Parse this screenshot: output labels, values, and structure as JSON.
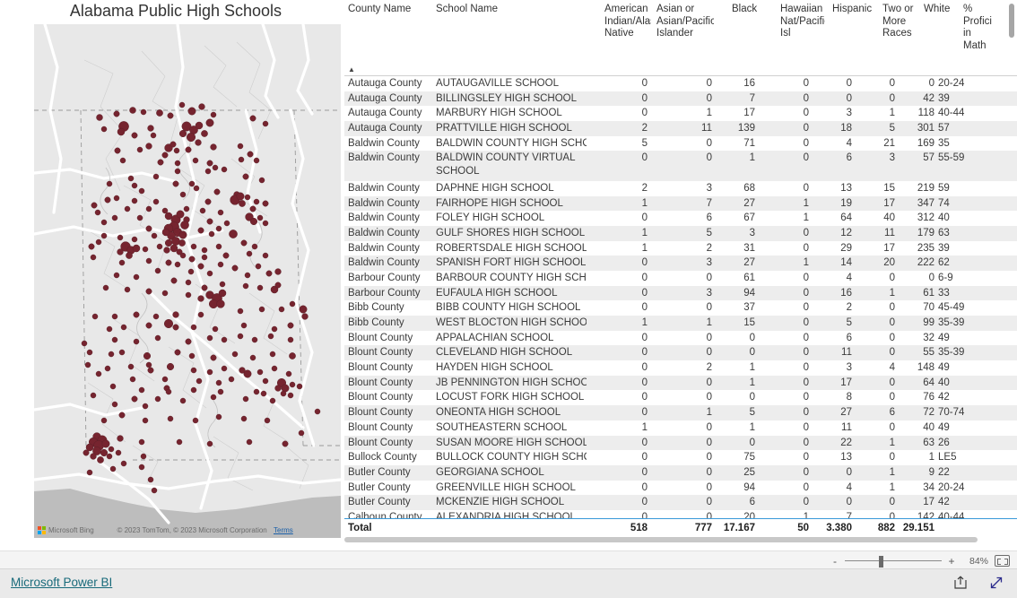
{
  "map": {
    "title": "Alabama Public High Schools",
    "attribution": "© 2023 TomTom, © 2023 Microsoft Corporation",
    "terms_label": "Terms",
    "bing_label": "Microsoft Bing",
    "bubble_color": "#6d1420",
    "background_color": "#e8e8e8",
    "water_color": "#b9b9b9",
    "road_color": "#ffffff"
  },
  "table": {
    "columns": [
      {
        "key": "county",
        "label": "County Name",
        "type": "text"
      },
      {
        "key": "school",
        "label": "School Name",
        "type": "text"
      },
      {
        "key": "amerind",
        "label": "American Indian/Alaska Native",
        "type": "num"
      },
      {
        "key": "asian",
        "label": "Asian or Asian/Pacific Islander",
        "type": "num"
      },
      {
        "key": "black",
        "label": "Black",
        "type": "num"
      },
      {
        "key": "hawaiian",
        "label": "Hawaiian Nat/Pacific Isl",
        "type": "num"
      },
      {
        "key": "hispanic",
        "label": "Hispanic",
        "type": "num"
      },
      {
        "key": "twomore",
        "label": "Two or More Races",
        "type": "num"
      },
      {
        "key": "white",
        "label": "White",
        "type": "num"
      },
      {
        "key": "mathprof",
        "label": "% Proficient in Math",
        "type": "num"
      }
    ],
    "sort_indicator": "▲",
    "rows": [
      {
        "county": "Autauga County",
        "school": "AUTAUGAVILLE SCHOOL",
        "amerind": "0",
        "asian": "0",
        "black": "16",
        "hawaiian": "0",
        "hispanic": "0",
        "twomore": "0",
        "white": "0",
        "mathprof": "20-24"
      },
      {
        "county": "Autauga County",
        "school": "BILLINGSLEY HIGH SCHOOL",
        "amerind": "0",
        "asian": "0",
        "black": "7",
        "hawaiian": "0",
        "hispanic": "0",
        "twomore": "0",
        "white": "42",
        "mathprof": "39"
      },
      {
        "county": "Autauga County",
        "school": "MARBURY HIGH SCHOOL",
        "amerind": "0",
        "asian": "1",
        "black": "17",
        "hawaiian": "0",
        "hispanic": "3",
        "twomore": "1",
        "white": "118",
        "mathprof": "40-44"
      },
      {
        "county": "Autauga County",
        "school": "PRATTVILLE HIGH SCHOOL",
        "amerind": "2",
        "asian": "11",
        "black": "139",
        "hawaiian": "0",
        "hispanic": "18",
        "twomore": "5",
        "white": "301",
        "mathprof": "57"
      },
      {
        "county": "Baldwin County",
        "school": "BALDWIN COUNTY HIGH SCHOOL",
        "amerind": "5",
        "asian": "0",
        "black": "71",
        "hawaiian": "0",
        "hispanic": "4",
        "twomore": "21",
        "white": "169",
        "mathprof": "35"
      },
      {
        "county": "Baldwin County",
        "school": "BALDWIN COUNTY VIRTUAL SCHOOL",
        "amerind": "0",
        "asian": "0",
        "black": "1",
        "hawaiian": "0",
        "hispanic": "6",
        "twomore": "3",
        "white": "57",
        "mathprof": "55-59",
        "tall": true
      },
      {
        "county": "Baldwin County",
        "school": "DAPHNE HIGH SCHOOL",
        "amerind": "2",
        "asian": "3",
        "black": "68",
        "hawaiian": "0",
        "hispanic": "13",
        "twomore": "15",
        "white": "219",
        "mathprof": "59"
      },
      {
        "county": "Baldwin County",
        "school": "FAIRHOPE HIGH SCHOOL",
        "amerind": "1",
        "asian": "7",
        "black": "27",
        "hawaiian": "1",
        "hispanic": "19",
        "twomore": "17",
        "white": "347",
        "mathprof": "74"
      },
      {
        "county": "Baldwin County",
        "school": "FOLEY HIGH SCHOOL",
        "amerind": "0",
        "asian": "6",
        "black": "67",
        "hawaiian": "1",
        "hispanic": "64",
        "twomore": "40",
        "white": "312",
        "mathprof": "40"
      },
      {
        "county": "Baldwin County",
        "school": "GULF SHORES HIGH SCHOOL",
        "amerind": "1",
        "asian": "5",
        "black": "3",
        "hawaiian": "0",
        "hispanic": "12",
        "twomore": "11",
        "white": "179",
        "mathprof": "63"
      },
      {
        "county": "Baldwin County",
        "school": "ROBERTSDALE HIGH SCHOOL",
        "amerind": "1",
        "asian": "2",
        "black": "31",
        "hawaiian": "0",
        "hispanic": "29",
        "twomore": "17",
        "white": "235",
        "mathprof": "39"
      },
      {
        "county": "Baldwin County",
        "school": "SPANISH FORT HIGH SCHOOL",
        "amerind": "0",
        "asian": "3",
        "black": "27",
        "hawaiian": "1",
        "hispanic": "14",
        "twomore": "20",
        "white": "222",
        "mathprof": "62"
      },
      {
        "county": "Barbour County",
        "school": "BARBOUR COUNTY HIGH SCHOOL",
        "amerind": "0",
        "asian": "0",
        "black": "61",
        "hawaiian": "0",
        "hispanic": "4",
        "twomore": "0",
        "white": "0",
        "mathprof": "6-9"
      },
      {
        "county": "Barbour County",
        "school": "EUFAULA HIGH SCHOOL",
        "amerind": "0",
        "asian": "3",
        "black": "94",
        "hawaiian": "0",
        "hispanic": "16",
        "twomore": "1",
        "white": "61",
        "mathprof": "33"
      },
      {
        "county": "Bibb County",
        "school": "BIBB COUNTY HIGH SCHOOL",
        "amerind": "0",
        "asian": "0",
        "black": "37",
        "hawaiian": "0",
        "hispanic": "2",
        "twomore": "0",
        "white": "70",
        "mathprof": "45-49"
      },
      {
        "county": "Bibb County",
        "school": "WEST BLOCTON HIGH SCHOOL",
        "amerind": "1",
        "asian": "1",
        "black": "15",
        "hawaiian": "0",
        "hispanic": "5",
        "twomore": "0",
        "white": "99",
        "mathprof": "35-39"
      },
      {
        "county": "Blount County",
        "school": "APPALACHIAN SCHOOL",
        "amerind": "0",
        "asian": "0",
        "black": "0",
        "hawaiian": "0",
        "hispanic": "6",
        "twomore": "0",
        "white": "32",
        "mathprof": "49"
      },
      {
        "county": "Blount County",
        "school": "CLEVELAND HIGH SCHOOL",
        "amerind": "0",
        "asian": "0",
        "black": "0",
        "hawaiian": "0",
        "hispanic": "11",
        "twomore": "0",
        "white": "55",
        "mathprof": "35-39"
      },
      {
        "county": "Blount County",
        "school": "HAYDEN HIGH SCHOOL",
        "amerind": "0",
        "asian": "2",
        "black": "1",
        "hawaiian": "0",
        "hispanic": "3",
        "twomore": "4",
        "white": "148",
        "mathprof": "49"
      },
      {
        "county": "Blount County",
        "school": "JB PENNINGTON HIGH SCHOOL",
        "amerind": "0",
        "asian": "0",
        "black": "1",
        "hawaiian": "0",
        "hispanic": "17",
        "twomore": "0",
        "white": "64",
        "mathprof": "40"
      },
      {
        "county": "Blount County",
        "school": "LOCUST FORK HIGH SCHOOL",
        "amerind": "0",
        "asian": "0",
        "black": "0",
        "hawaiian": "0",
        "hispanic": "8",
        "twomore": "0",
        "white": "76",
        "mathprof": "42"
      },
      {
        "county": "Blount County",
        "school": "ONEONTA HIGH SCHOOL",
        "amerind": "0",
        "asian": "1",
        "black": "5",
        "hawaiian": "0",
        "hispanic": "27",
        "twomore": "6",
        "white": "72",
        "mathprof": "70-74"
      },
      {
        "county": "Blount County",
        "school": "SOUTHEASTERN SCHOOL",
        "amerind": "1",
        "asian": "0",
        "black": "1",
        "hawaiian": "0",
        "hispanic": "11",
        "twomore": "0",
        "white": "40",
        "mathprof": "49"
      },
      {
        "county": "Blount County",
        "school": "SUSAN MOORE HIGH SCHOOL",
        "amerind": "0",
        "asian": "0",
        "black": "0",
        "hawaiian": "0",
        "hispanic": "22",
        "twomore": "1",
        "white": "63",
        "mathprof": "26"
      },
      {
        "county": "Bullock County",
        "school": "BULLOCK COUNTY HIGH SCHOOL",
        "amerind": "0",
        "asian": "0",
        "black": "75",
        "hawaiian": "0",
        "hispanic": "13",
        "twomore": "0",
        "white": "1",
        "mathprof": "LE5"
      },
      {
        "county": "Butler County",
        "school": "GEORGIANA SCHOOL",
        "amerind": "0",
        "asian": "0",
        "black": "25",
        "hawaiian": "0",
        "hispanic": "0",
        "twomore": "1",
        "white": "9",
        "mathprof": "22"
      },
      {
        "county": "Butler County",
        "school": "GREENVILLE HIGH SCHOOL",
        "amerind": "0",
        "asian": "0",
        "black": "94",
        "hawaiian": "0",
        "hispanic": "4",
        "twomore": "1",
        "white": "34",
        "mathprof": "20-24"
      },
      {
        "county": "Butler County",
        "school": "MCKENZIE HIGH SCHOOL",
        "amerind": "0",
        "asian": "0",
        "black": "6",
        "hawaiian": "0",
        "hispanic": "0",
        "twomore": "0",
        "white": "17",
        "mathprof": "42"
      },
      {
        "county": "Calhoun County",
        "school": "ALEXANDRIA HIGH SCHOOL",
        "amerind": "0",
        "asian": "0",
        "black": "20",
        "hawaiian": "1",
        "hispanic": "7",
        "twomore": "0",
        "white": "142",
        "mathprof": "40-44",
        "clipped": true
      }
    ],
    "total": {
      "label": "Total",
      "amerind": "518",
      "asian": "777",
      "black": "17.167",
      "hawaiian": "50",
      "hispanic": "3.380",
      "twomore": "882",
      "white": "29.151",
      "mathprof": ""
    }
  },
  "footer": {
    "powerbi_label": "Microsoft Power BI",
    "zoom_percent": "84%",
    "zoom_minus": "-",
    "zoom_plus": "+",
    "fit_icon": "fit-to-page-icon",
    "share_icon": "share-icon",
    "fullscreen_icon": "fullscreen-icon"
  }
}
